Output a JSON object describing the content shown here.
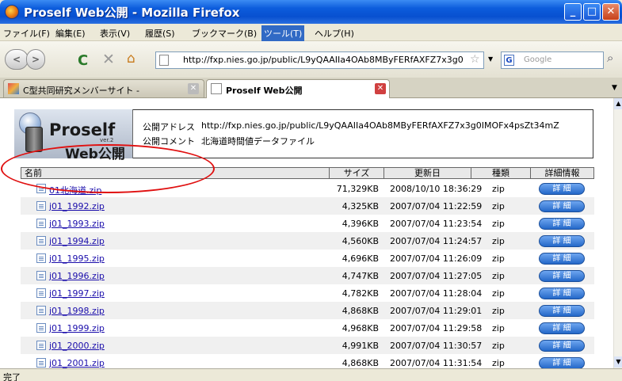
{
  "window": {
    "title": "Proself Web公開 - Mozilla Firefox",
    "min": "_",
    "max": "□",
    "close": "✕"
  },
  "menu": [
    "ファイル(F)",
    "編集(E)",
    "表示(V)",
    "履歴(S)",
    "ブックマーク(B)",
    "ツール(T)",
    "ヘルプ(H)"
  ],
  "nav": {
    "url": "http://fxp.nies.go.jp/public/L9yQAAIIa4OAb8MByFERfAXFZ7x3g0",
    "search_placeholder": "Google",
    "google_glyph": "G"
  },
  "tabs": [
    {
      "label": "C型共同研究メンバーサイト -",
      "active": false
    },
    {
      "label": "Proself Web公開",
      "active": true
    }
  ],
  "logo": {
    "name": "Proself",
    "ver": "ver.2",
    "sub": "Web公開"
  },
  "header": {
    "addr_label": "公開アドレス",
    "addr": "http://fxp.nies.go.jp/public/L9yQAAIIa4OAb8MByFERfAXFZ7x3g0IMOFx4psZt34mZ",
    "comment_label": "公開コメント",
    "comment": "北海道時間値データファイル"
  },
  "table": {
    "columns": [
      "名前",
      "サイズ",
      "更新日",
      "種類",
      "詳細情報"
    ],
    "detail_label": "詳 細",
    "rows": [
      {
        "name": "01北海道.zip",
        "size": "71,329KB",
        "date": "2008/10/10 18:36:29",
        "type": "zip"
      },
      {
        "name": "j01_1992.zip",
        "size": "4,325KB",
        "date": "2007/07/04 11:22:59",
        "type": "zip"
      },
      {
        "name": "j01_1993.zip",
        "size": "4,396KB",
        "date": "2007/07/04 11:23:54",
        "type": "zip"
      },
      {
        "name": "j01_1994.zip",
        "size": "4,560KB",
        "date": "2007/07/04 11:24:57",
        "type": "zip"
      },
      {
        "name": "j01_1995.zip",
        "size": "4,696KB",
        "date": "2007/07/04 11:26:09",
        "type": "zip"
      },
      {
        "name": "j01_1996.zip",
        "size": "4,747KB",
        "date": "2007/07/04 11:27:05",
        "type": "zip"
      },
      {
        "name": "j01_1997.zip",
        "size": "4,782KB",
        "date": "2007/07/04 11:28:04",
        "type": "zip"
      },
      {
        "name": "j01_1998.zip",
        "size": "4,868KB",
        "date": "2007/07/04 11:29:01",
        "type": "zip"
      },
      {
        "name": "j01_1999.zip",
        "size": "4,968KB",
        "date": "2007/07/04 11:29:58",
        "type": "zip"
      },
      {
        "name": "j01_2000.zip",
        "size": "4,991KB",
        "date": "2007/07/04 11:30:57",
        "type": "zip"
      },
      {
        "name": "j01_2001.zip",
        "size": "4,868KB",
        "date": "2007/07/04 11:31:54",
        "type": "zip"
      }
    ]
  },
  "status": "完了"
}
